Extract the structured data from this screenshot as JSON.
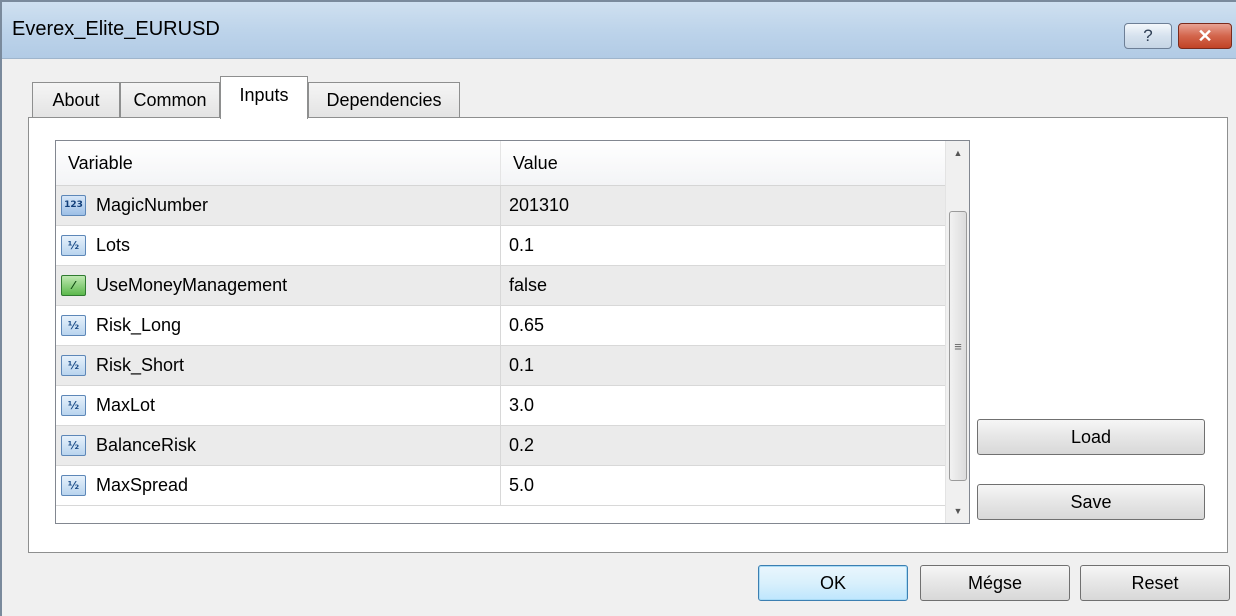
{
  "window": {
    "title": "Everex_Elite_EURUSD"
  },
  "titlebar": {
    "help_label": "?",
    "close_label": "✕"
  },
  "tabs": [
    {
      "label": "About"
    },
    {
      "label": "Common"
    },
    {
      "label": "Inputs",
      "active": true
    },
    {
      "label": "Dependencies"
    }
  ],
  "table": {
    "headers": {
      "variable": "Variable",
      "value": "Value"
    },
    "rows": [
      {
        "icon": "integer-icon",
        "icon_text": "123",
        "variable": "MagicNumber",
        "value": "201310"
      },
      {
        "icon": "double-icon",
        "icon_text": "½",
        "variable": "Lots",
        "value": "0.1"
      },
      {
        "icon": "bool-icon",
        "icon_text": "⁄",
        "variable": "UseMoneyManagement",
        "value": "false"
      },
      {
        "icon": "double-icon",
        "icon_text": "½",
        "variable": "Risk_Long",
        "value": "0.65"
      },
      {
        "icon": "double-icon",
        "icon_text": "½",
        "variable": "Risk_Short",
        "value": "0.1"
      },
      {
        "icon": "double-icon",
        "icon_text": "½",
        "variable": "MaxLot",
        "value": "3.0"
      },
      {
        "icon": "double-icon",
        "icon_text": "½",
        "variable": "BalanceRisk",
        "value": "0.2"
      },
      {
        "icon": "double-icon",
        "icon_text": "½",
        "variable": "MaxSpread",
        "value": "5.0"
      }
    ]
  },
  "side_buttons": {
    "load": "Load",
    "save": "Save"
  },
  "footer": {
    "ok": "OK",
    "cancel": "Mégse",
    "reset": "Reset"
  }
}
